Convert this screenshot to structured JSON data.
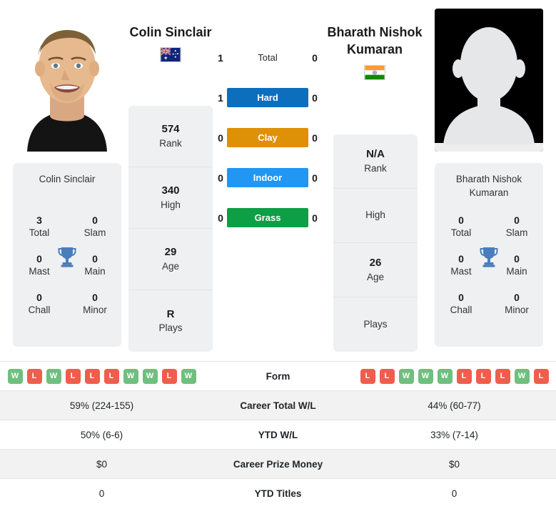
{
  "players": {
    "left": {
      "name": "Colin Sinclair",
      "flag": "australia-flag",
      "photo": "player-photo",
      "rank": "574",
      "rank_label": "Rank",
      "high": "340",
      "high_label": "High",
      "age": "29",
      "age_label": "Age",
      "plays": "R",
      "plays_label": "Plays",
      "titles": {
        "card_name": "Colin Sinclair",
        "total": "3",
        "total_label": "Total",
        "slam": "0",
        "slam_label": "Slam",
        "mast": "0",
        "mast_label": "Mast",
        "main": "0",
        "main_label": "Main",
        "chall": "0",
        "chall_label": "Chall",
        "minor": "0",
        "minor_label": "Minor"
      },
      "form": [
        "W",
        "L",
        "W",
        "L",
        "L",
        "L",
        "W",
        "W",
        "L",
        "W"
      ],
      "career_wl": "59% (224-155)",
      "ytd_wl": "50% (6-6)",
      "career_prize": "$0",
      "ytd_titles": "0"
    },
    "right": {
      "name": "Bharath Nishok Kumaran",
      "flag": "india-flag",
      "photo": "player-photo-placeholder",
      "rank": "N/A",
      "rank_label": "Rank",
      "high": "",
      "high_label": "High",
      "age": "26",
      "age_label": "Age",
      "plays": "",
      "plays_label": "Plays",
      "titles": {
        "card_name": "Bharath Nishok Kumaran",
        "total": "0",
        "total_label": "Total",
        "slam": "0",
        "slam_label": "Slam",
        "mast": "0",
        "mast_label": "Mast",
        "main": "0",
        "main_label": "Main",
        "chall": "0",
        "chall_label": "Chall",
        "minor": "0",
        "minor_label": "Minor"
      },
      "form": [
        "L",
        "L",
        "W",
        "W",
        "W",
        "L",
        "L",
        "L",
        "W",
        "L"
      ],
      "career_wl": "44% (60-77)",
      "ytd_wl": "33% (7-14)",
      "career_prize": "$0",
      "ytd_titles": "0"
    }
  },
  "h2h": [
    {
      "left": "1",
      "label": "Total",
      "right": "0",
      "badge": false,
      "color": ""
    },
    {
      "left": "1",
      "label": "Hard",
      "right": "0",
      "badge": true,
      "color": "#0d6ebd"
    },
    {
      "left": "0",
      "label": "Clay",
      "right": "0",
      "badge": true,
      "color": "#de9007"
    },
    {
      "left": "0",
      "label": "Indoor",
      "right": "0",
      "badge": true,
      "color": "#2196f3"
    },
    {
      "left": "0",
      "label": "Grass",
      "right": "0",
      "badge": true,
      "color": "#0e9e46"
    }
  ],
  "table": {
    "rows": [
      {
        "label": "Form",
        "left": "",
        "right": "",
        "type": "form"
      },
      {
        "label": "Career Total W/L",
        "left": "59% (224-155)",
        "right": "44% (60-77)",
        "type": "text"
      },
      {
        "label": "YTD W/L",
        "left": "50% (6-6)",
        "right": "33% (7-14)",
        "type": "text"
      },
      {
        "label": "Career Prize Money",
        "left": "$0",
        "right": "$0",
        "type": "text"
      },
      {
        "label": "YTD Titles",
        "left": "0",
        "right": "0",
        "type": "text"
      }
    ]
  },
  "colors": {
    "win": "#6fbf7e",
    "loss": "#ef5d4c",
    "hard": "#0d6ebd",
    "clay": "#de9007",
    "indoor": "#2196f3",
    "grass": "#0e9e46",
    "trophy": "#4a7ebb",
    "card_bg": "#eff0f1"
  }
}
